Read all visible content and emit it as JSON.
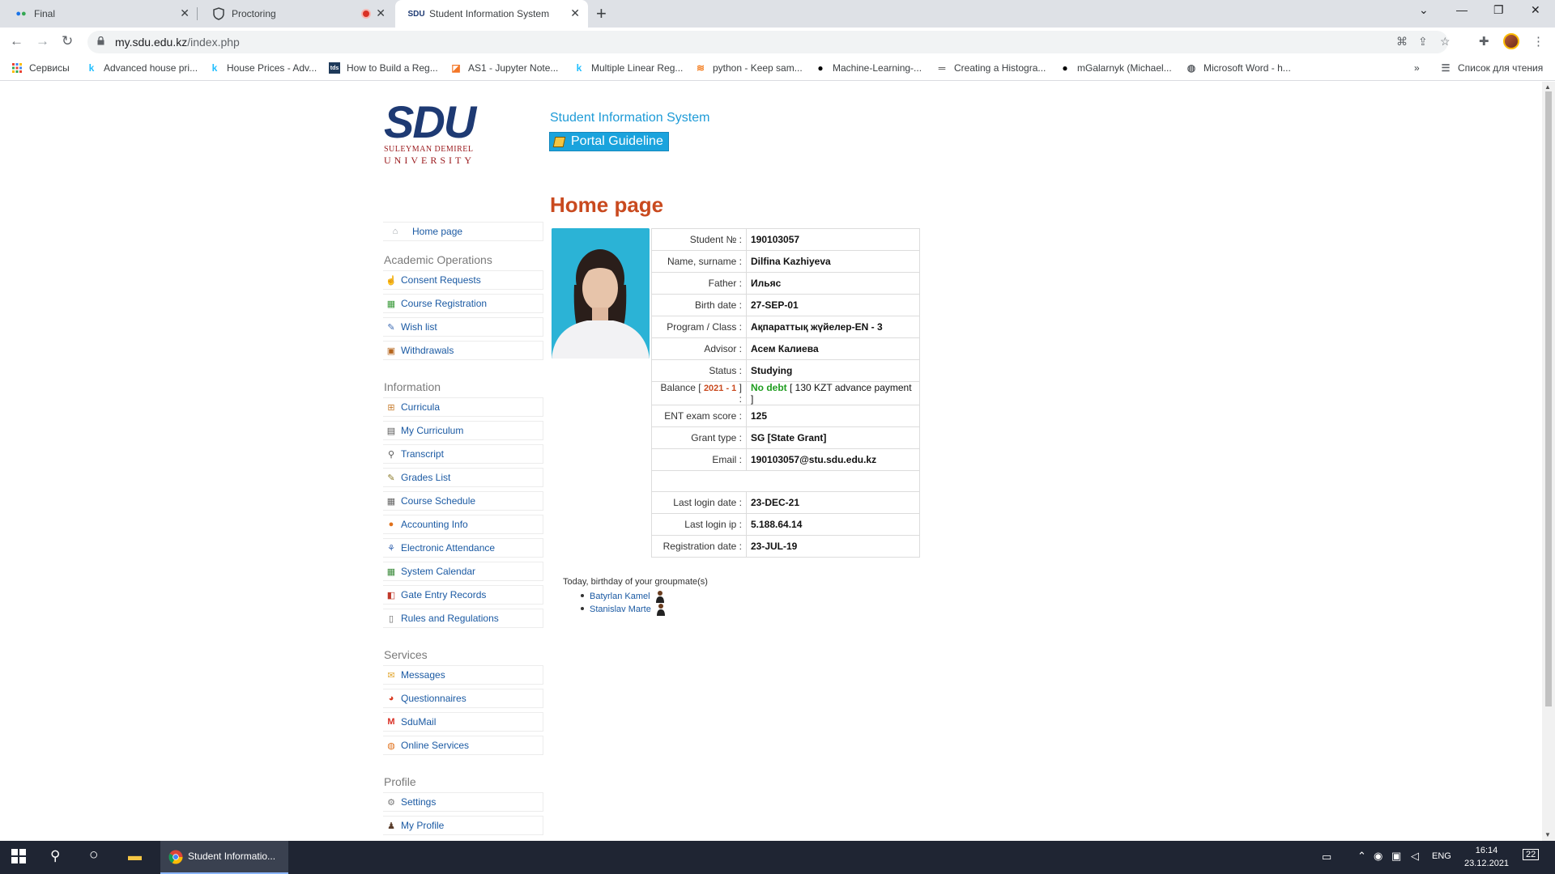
{
  "browser": {
    "tabs": [
      {
        "title": "Final",
        "active": false
      },
      {
        "title": "Proctoring",
        "active": false,
        "recording": true
      },
      {
        "title": "Student Information System",
        "active": true
      }
    ],
    "url_host": "my.sdu.edu.kz",
    "url_path": "/index.php",
    "bookmarks": [
      {
        "label": "Сервисы",
        "icon": "apps-grid-icon"
      },
      {
        "label": "Advanced house pri...",
        "icon": "kaggle-icon"
      },
      {
        "label": "House Prices - Adv...",
        "icon": "kaggle-icon"
      },
      {
        "label": "How to Build a Reg...",
        "icon": "site-icon"
      },
      {
        "label": "AS1 - Jupyter Note...",
        "icon": "jupyter-icon"
      },
      {
        "label": "Multiple Linear Reg...",
        "icon": "kaggle-icon"
      },
      {
        "label": "python - Keep sam...",
        "icon": "stackoverflow-icon"
      },
      {
        "label": "Machine-Learning-...",
        "icon": "github-icon"
      },
      {
        "label": "Creating a Histogra...",
        "icon": "site-icon"
      },
      {
        "label": "mGalarnyk (Michael...",
        "icon": "github-icon"
      },
      {
        "label": "Microsoft Word - h...",
        "icon": "globe-icon"
      }
    ],
    "more_bookmarks": "»",
    "reading_list": "Список для чтения"
  },
  "page": {
    "logo_line1": "SULEYMAN DEMIREL",
    "logo_line2": "UNIVERSITY",
    "logo_mark": "SDU",
    "system_title": "Student Information System",
    "portal_guideline": "Portal Guideline",
    "home_title": "Home page",
    "sidebar": {
      "home": "Home page",
      "sections": [
        {
          "title": "Academic Operations",
          "items": [
            "Consent Requests",
            "Course Registration",
            "Wish list",
            "Withdrawals"
          ]
        },
        {
          "title": "Information",
          "items": [
            "Curricula",
            "My Curriculum",
            "Transcript",
            "Grades List",
            "Course Schedule",
            "Accounting Info",
            "Electronic Attendance",
            "System Calendar",
            "Gate Entry Records",
            "Rules and Regulations"
          ]
        },
        {
          "title": "Services",
          "items": [
            "Messages",
            "Questionnaires",
            "SduMail",
            "Online Services"
          ]
        },
        {
          "title": "Profile",
          "items": [
            "Settings",
            "My Profile"
          ]
        }
      ]
    },
    "student": {
      "number_label": "Student № :",
      "number": "190103057",
      "name_label": "Name, surname :",
      "name": "Dilfina Kazhiyeva",
      "father_label": "Father :",
      "father": "Ильяс",
      "birth_label": "Birth date :",
      "birth": "27-SEP-01",
      "program_label": "Program / Class :",
      "program": "Ақпараттық жүйелер-EN - 3",
      "advisor_label": "Advisor :",
      "advisor": "Асем Калиева",
      "status_label": "Status :",
      "status": "Studying",
      "balance_label_pre": "Balance [",
      "balance_period": "2021 - 1",
      "balance_label_post": "] :",
      "balance_status": "No debt",
      "balance_detail": "[ 130 KZT advance payment ]",
      "ent_label": "ENT exam score :",
      "ent": "125",
      "grant_label": "Grant type :",
      "grant": "SG [State Grant]",
      "email_label": "Email :",
      "email": "190103057@stu.sdu.edu.kz",
      "last_login_date_label": "Last login date :",
      "last_login_date": "23-DEC-21",
      "last_login_ip_label": "Last login ip :",
      "last_login_ip": "5.188.64.14",
      "registration_label": "Registration date :",
      "registration": "23-JUL-19"
    },
    "birthday_heading": "Today, birthday of your groupmate(s)",
    "birthday_people": [
      "Batyrlan Kamel",
      "Stanislav Marte"
    ]
  },
  "taskbar": {
    "active_app": "Student Informatio...",
    "lang": "ENG",
    "time": "16:14",
    "date": "23.12.2021",
    "notifications": "22"
  }
}
